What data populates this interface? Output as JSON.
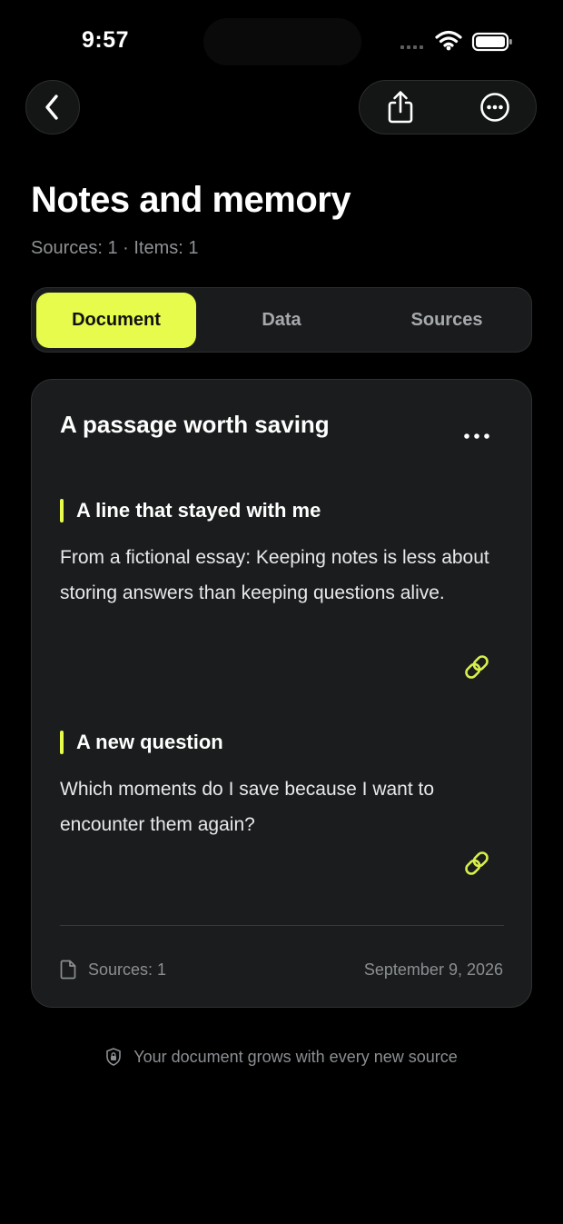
{
  "status_bar": {
    "time": "9:57",
    "icons": [
      "cellular-signal-icon",
      "wifi-icon",
      "battery-icon"
    ]
  },
  "nav": {
    "back_icon": "chevron-left-icon",
    "share_icon": "share-icon",
    "more_icon": "ellipsis-circle-icon"
  },
  "header": {
    "title": "Notes and memory",
    "subtitle": "Sources: 1 · Items: 1"
  },
  "tabs": [
    {
      "label": "Document",
      "active": true
    },
    {
      "label": "Data",
      "active": false
    },
    {
      "label": "Sources",
      "active": false
    }
  ],
  "card": {
    "title": "A passage worth saving",
    "menu_icon": "ellipsis-icon",
    "sections": [
      {
        "heading": "A line that stayed with me",
        "body": "From a fictional essay: Keeping notes is less about storing answers than keeping questions alive.",
        "icon": "link-icon"
      },
      {
        "heading": "A new question",
        "body": "Which moments do I save because I want to encounter them again?",
        "icon": "link-icon"
      }
    ],
    "footer": {
      "sources_label": "Sources: 1",
      "sources_icon": "document-icon",
      "date": "September 9, 2026"
    }
  },
  "bottom_note": {
    "icon": "lock-shield-icon",
    "text": "Your document grows with every new source"
  },
  "colors": {
    "background": "#000000",
    "card": "#1a1c1d",
    "accent": "#e6fb4b",
    "muted_text": "#8e9194"
  }
}
